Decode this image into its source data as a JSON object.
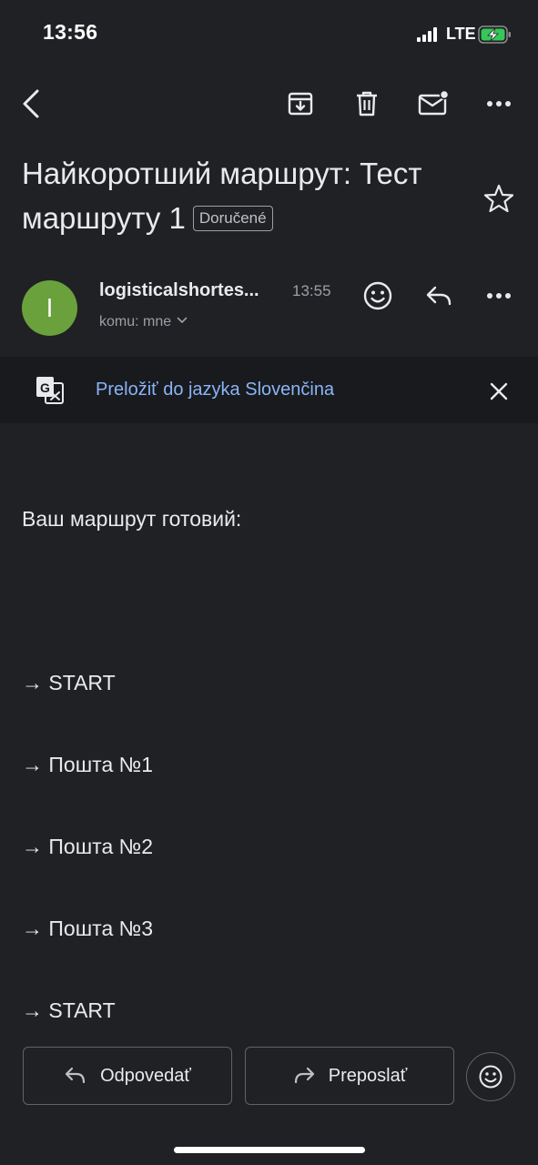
{
  "status_bar": {
    "time": "13:56",
    "network": "LTE",
    "battery_charging": true
  },
  "toolbar": {
    "icons": [
      "back-icon",
      "archive-icon",
      "trash-icon",
      "mark-unread-icon",
      "more-icon"
    ]
  },
  "subject": {
    "title": "Найкоротший маршрут: Тест маршруту 1",
    "label": "Doručené"
  },
  "sender": {
    "avatar_letter": "l",
    "avatar_color": "#6aa13c",
    "name": "logisticalshortes...",
    "time": "13:55",
    "recipient": "komu: mne"
  },
  "translate": {
    "link": "Preložiť do jazyka Slovenčina"
  },
  "body": {
    "intro": "Ваш маршрут готовий:",
    "route": [
      "→ START",
      "→ Пошта №1",
      "→ Пошта №2",
      "→ Пошта №3",
      "→ START"
    ]
  },
  "actions": {
    "reply": "Odpovedať",
    "forward": "Preposlať"
  },
  "colors": {
    "background": "#202124",
    "translate_bar": "#191a1d",
    "link": "#8ab4f8"
  }
}
